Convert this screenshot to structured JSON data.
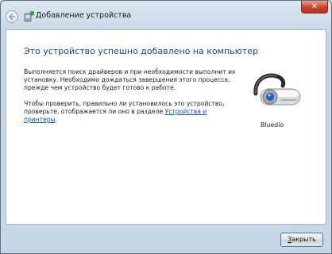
{
  "window": {
    "title": "Добавление устройства",
    "close_label": "✕"
  },
  "main": {
    "heading": "Это устройство успешно добавлено на компьютер",
    "para1": "Выполняется поиск драйверов и при необходимости выполнит их установку. Необходимо дождаться завершения этого процесса, прежде чем устройство будет готово к работе.",
    "para2_text": "Чтобы проверить, правильно ли установилось это устройство, проверьте, отображается ли оно в разделе ",
    "para2_link": "Устройства и принтеры",
    "para2_end": ".",
    "device_name": "Bluedio"
  },
  "footer": {
    "finish_accel": "З",
    "finish_rest": "акрыть"
  }
}
